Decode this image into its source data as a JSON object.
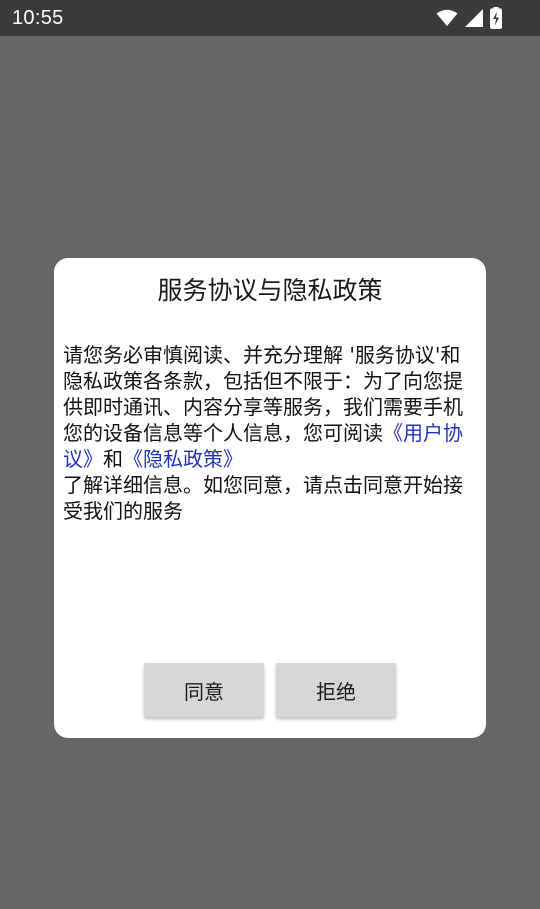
{
  "status_bar": {
    "time": "10:55",
    "icons": [
      "wifi-icon",
      "signal-icon",
      "battery-charging-icon"
    ]
  },
  "dialog": {
    "title": "服务协议与隐私政策",
    "body_intro": "请您务必审慎阅读、并充分理解 '服务协议'和隐私政策各条款，包括但不限于：为了向您提供即时通讯、内容分享等服务，我们需要手机您的设备信息等个人信息，您可阅读",
    "user_agreement_link": "《用户协议》",
    "and_text": "和",
    "privacy_policy_link": "《隐私政策》",
    "body_outro": "了解详细信息。如您同意，请点击同意开始接受我们的服务",
    "agree_label": "同意",
    "refuse_label": "拒绝"
  },
  "colors": {
    "backdrop": "#666666",
    "status_bar": "#3a3a3a",
    "link": "#2233bb",
    "button": "#d6d7d7"
  }
}
